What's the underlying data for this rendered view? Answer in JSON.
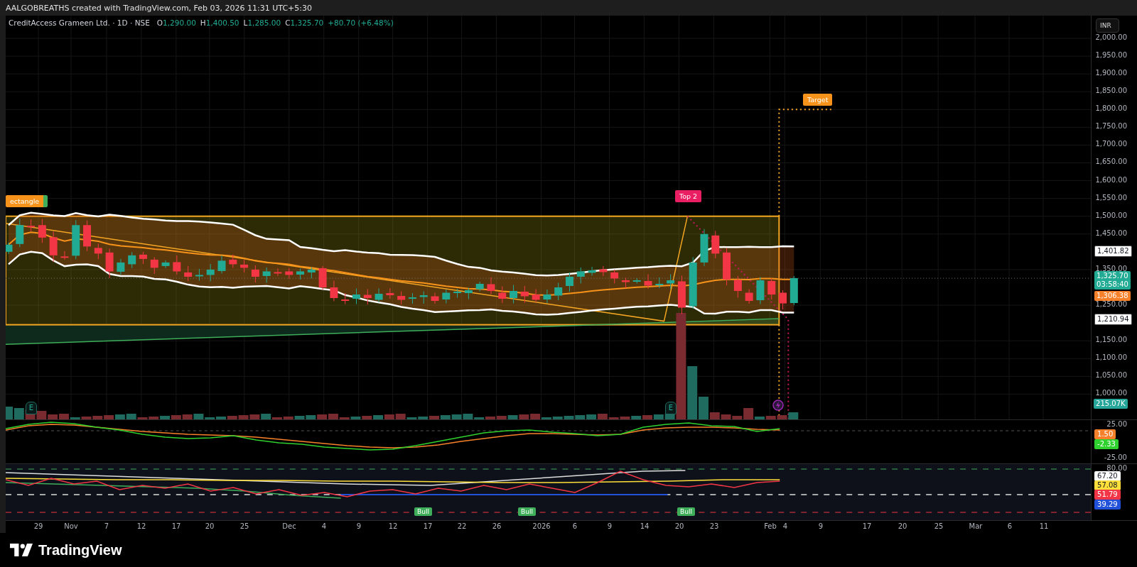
{
  "header": {
    "text": "AALGOBREATHS created with TradingView.com, Feb 03, 2026 11:31 UTC+5:30"
  },
  "legend": {
    "symbol": "CreditAccess Grameen Ltd. · 1D · NSE",
    "ohlc": [
      {
        "label": "O",
        "value": "1,290.00"
      },
      {
        "label": "H",
        "value": "1,400.50"
      },
      {
        "label": "L",
        "value": "1,285.00"
      },
      {
        "label": "C",
        "value": "1,325.70"
      }
    ],
    "change": "+80.70 (+6.48%)"
  },
  "price_axis": {
    "currency": "INR",
    "ticks": [
      "2,000.00",
      "1,950.00",
      "1,900.00",
      "1,850.00",
      "1,800.00",
      "1,750.00",
      "1,700.00",
      "1,650.00",
      "1,600.00",
      "1,550.00",
      "1,500.00",
      "1,450.00",
      "1,350.00",
      "1,250.00",
      "1,150.00",
      "1,100.00",
      "1,050.00",
      "1,000.00"
    ],
    "markers": [
      {
        "kind": "band",
        "value": "1,401.82",
        "color": "#ffffff"
      },
      {
        "kind": "last",
        "value": "1,325.70",
        "countdown": "03:58:40",
        "color": "#22ab94"
      },
      {
        "kind": "average",
        "value": "1,306.38",
        "color": "#f7812a"
      },
      {
        "kind": "band",
        "value": "1,210.94",
        "color": "#ffffff"
      },
      {
        "kind": "volume",
        "value": "215.07K",
        "color": "#26a69a"
      }
    ]
  },
  "annotations": [
    {
      "kind": "rectangle",
      "text": "ectangle"
    },
    {
      "kind": "top",
      "text": "Top 2"
    },
    {
      "kind": "target",
      "text": "Target"
    }
  ],
  "earnings_markers": [
    "E",
    "E"
  ],
  "oscillator": {
    "ticks": [
      "25.00",
      "-25.00"
    ],
    "markers": [
      {
        "value": "1.50",
        "color": "#f7812a"
      },
      {
        "value": "-2.33",
        "color": "#2ed12e"
      }
    ]
  },
  "rsi": {
    "ticks": [
      "80.00"
    ],
    "markers": [
      {
        "value": "67.20",
        "color": "#ffffff"
      },
      {
        "value": "57.08",
        "color": "#ffe03a"
      },
      {
        "value": "51.79",
        "color": "#f23645"
      },
      {
        "value": "39.29",
        "color": "#2151d9"
      }
    ],
    "signals": [
      "Bull",
      "Bull",
      "Bull"
    ]
  },
  "time_axis": [
    "29",
    "Nov",
    "7",
    "12",
    "17",
    "20",
    "25",
    "Dec",
    "4",
    "9",
    "12",
    "17",
    "22",
    "26",
    "2026",
    "6",
    "9",
    "14",
    "20",
    "23",
    "Feb",
    "4",
    "9",
    "17",
    "20",
    "25",
    "Mar",
    "6",
    "11"
  ],
  "footer": {
    "brand": "TradingView"
  }
}
